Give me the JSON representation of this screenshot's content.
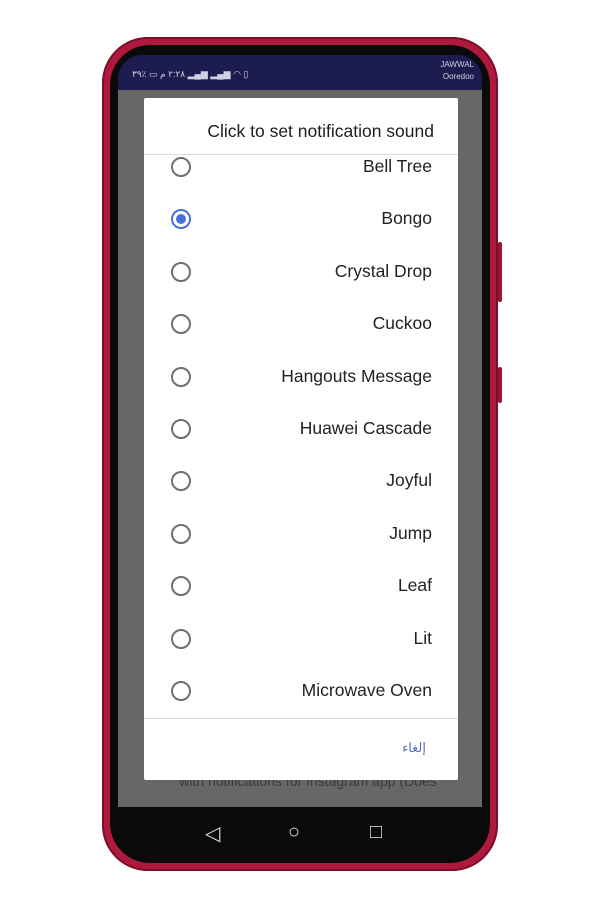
{
  "status_bar": {
    "time": "٢:٢٨ م",
    "battery": "٪٣٩",
    "carrier1": "JAWWAL",
    "carrier2": "Ooredoo"
  },
  "background": {
    "partial_text": "with notifications for Instagram app (Does"
  },
  "dialog": {
    "title": "Click to set notification sound",
    "options": [
      {
        "label": "Bell Tree",
        "selected": false
      },
      {
        "label": "Bongo",
        "selected": true
      },
      {
        "label": "Crystal Drop",
        "selected": false
      },
      {
        "label": "Cuckoo",
        "selected": false
      },
      {
        "label": "Hangouts Message",
        "selected": false
      },
      {
        "label": "Huawei Cascade",
        "selected": false
      },
      {
        "label": "Joyful",
        "selected": false
      },
      {
        "label": "Jump",
        "selected": false
      },
      {
        "label": "Leaf",
        "selected": false
      },
      {
        "label": "Lit",
        "selected": false
      },
      {
        "label": "Microwave Oven",
        "selected": false
      }
    ],
    "cancel_label": "إلغاء"
  },
  "colors": {
    "accent": "#4a6ee0",
    "phone_frame": "#b0193e",
    "status_bar": "#1c1c50"
  }
}
